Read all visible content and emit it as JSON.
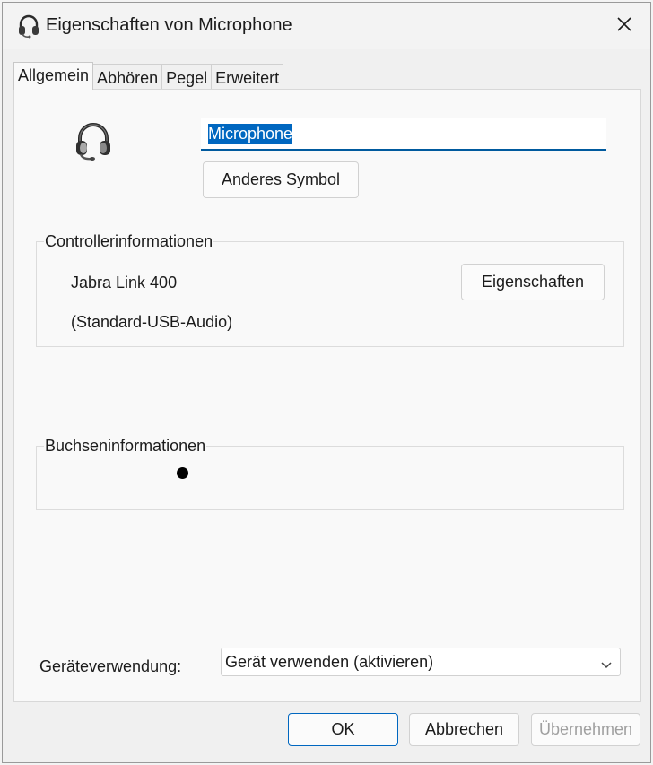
{
  "window": {
    "title": "Eigenschaften von Microphone",
    "title_icon": "headset-icon",
    "close_icon": "close-icon"
  },
  "tabs": [
    {
      "label": "Allgemein",
      "active": true
    },
    {
      "label": "Abhören",
      "active": false
    },
    {
      "label": "Pegel",
      "active": false
    },
    {
      "label": "Erweitert",
      "active": false
    }
  ],
  "general": {
    "device_icon": "headset-icon",
    "device_name": "Microphone",
    "change_icon_label": "Anderes Symbol",
    "controller": {
      "label": "Controllerinformationen",
      "name": "Jabra Link 400",
      "driver": "(Standard-USB-Audio)",
      "properties_label": "Eigenschaften"
    },
    "jack": {
      "label": "Buchseninformationen"
    },
    "usage": {
      "label": "Geräteverwendung:",
      "selected": "Gerät verwenden (aktivieren)"
    }
  },
  "footer": {
    "ok_label": "OK",
    "cancel_label": "Abbrechen",
    "apply_label": "Übernehmen"
  },
  "colors": {
    "accent": "#0067c0",
    "focus_underline": "#005a9e",
    "disabled_text": "#a0a0a0"
  }
}
